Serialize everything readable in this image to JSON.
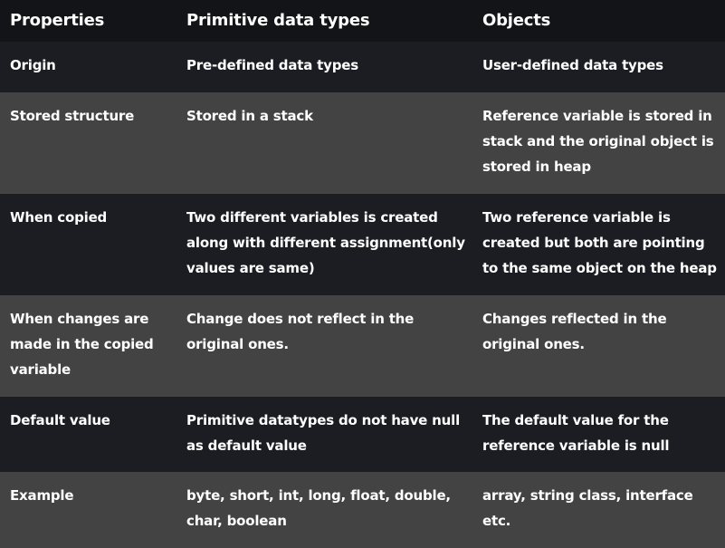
{
  "table": {
    "headers": [
      "Properties",
      "Primitive data types",
      "Objects"
    ],
    "rows": [
      [
        "Origin",
        "Pre-defined data types",
        "User-defined data types"
      ],
      [
        "Stored structure",
        "Stored in a stack",
        "Reference variable is stored in stack and the original object is stored in heap"
      ],
      [
        "When copied",
        "Two different variables is created along with different assignment(only values are same)",
        "Two reference variable is created but both are pointing to the same object on the heap"
      ],
      [
        "When changes are made in the copied variable",
        "Change does not reflect in the original ones.",
        "Changes reflected in the original ones."
      ],
      [
        "Default value",
        "Primitive datatypes do not have null as default value",
        "The default value for the reference variable is null"
      ],
      [
        "Example",
        "byte, short, int, long, float, double, char, boolean",
        "array, string class, interface etc."
      ]
    ]
  },
  "colors": {
    "header_bg": "#131417",
    "row_dark": "#1b1d22",
    "row_light": "#434343",
    "text": "#ffffff"
  }
}
